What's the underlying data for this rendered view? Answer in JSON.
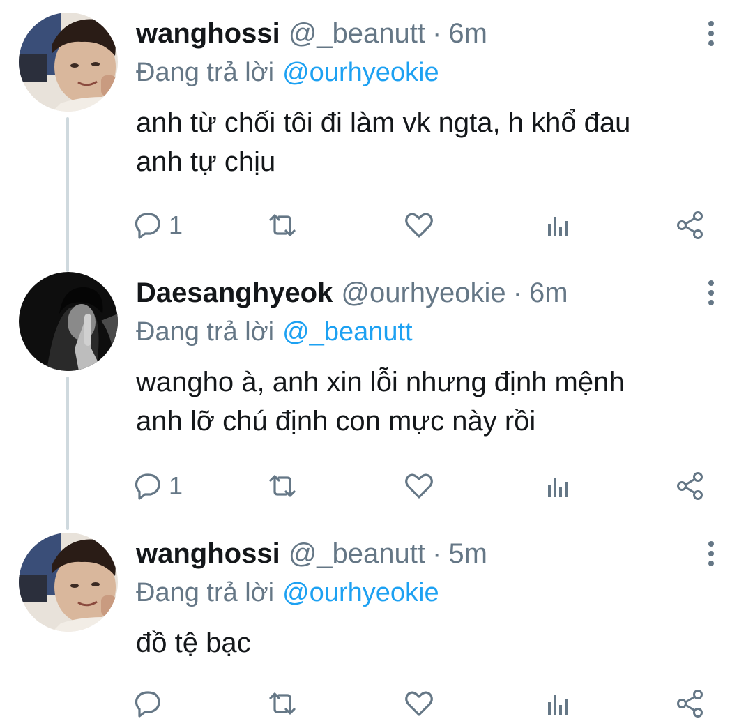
{
  "tweets": [
    {
      "display_name": "wanghossi",
      "handle": "@_beanutt",
      "separator": "·",
      "time": "6m",
      "reply_prefix": "Đang trả lời",
      "reply_to": "@ourhyeokie",
      "text_lines": [
        "anh từ chối tôi đi làm vk ngta, h khổ đau",
        "anh tự chịu"
      ],
      "reply_count": "1",
      "avatar": "light-photo-avatar"
    },
    {
      "display_name": "Daesanghyeok",
      "handle": "@ourhyeokie",
      "separator": "·",
      "time": "6m",
      "reply_prefix": "Đang trả lời",
      "reply_to": "@_beanutt",
      "text_lines": [
        "wangho à, anh xin lỗi nhưng định mệnh",
        "anh lỡ chú định con mực này rồi"
      ],
      "reply_count": "1",
      "avatar": "dark-photo-avatar"
    },
    {
      "display_name": "wanghossi",
      "handle": "@_beanutt",
      "separator": "·",
      "time": "5m",
      "reply_prefix": "Đang trả lời",
      "reply_to": "@ourhyeokie",
      "text_lines": [
        "đồ tệ bạc"
      ],
      "reply_count": "",
      "avatar": "light-photo-avatar"
    }
  ],
  "icons": {
    "reply": "reply-icon",
    "retweet": "retweet-icon",
    "like": "heart-icon",
    "stats": "stats-icon",
    "share": "share-icon",
    "more": "more-vertical-icon"
  },
  "colors": {
    "text": "#14171a",
    "secondary": "#657786",
    "link": "#1da1f2",
    "thread_line": "#cfd9de"
  }
}
